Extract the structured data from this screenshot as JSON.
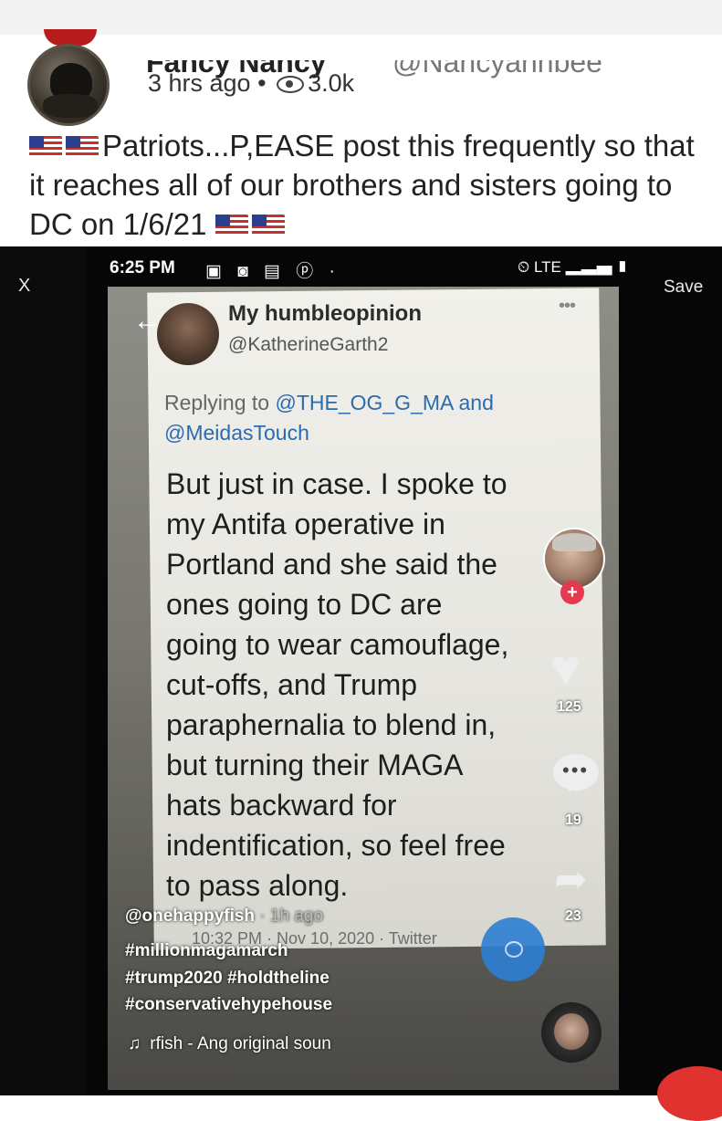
{
  "post": {
    "name": "Fancy Nancy",
    "handle": "@Nancyannbee",
    "time": "3 hrs ago",
    "separator": "•",
    "views": "3.0k",
    "text_main": "Patriots...P,EASE post this frequently so that it reaches all of our brothers and sisters going to DC on 1/6/21"
  },
  "video": {
    "status_time": "6:25 PM",
    "status_right": "LTE",
    "close_label": "X",
    "save_label": "Save",
    "tweet": {
      "name": "My humbleopinion",
      "handle": "@KatherineGarth2",
      "replying_prefix": "Replying to",
      "replying_to_1": "@THE_OG_G_MA and",
      "replying_to_2": "@MeidasTouch",
      "body_lines": [
        "But just in case. I spoke to",
        "my Antifa operative in",
        "Portland and she said the",
        "ones going to DC  are",
        "going to wear camouflage,",
        "cut-offs, and Trump",
        "paraphernalia to blend in,",
        "but turning their MAGA",
        "hats backward for",
        "indentification, so feel free",
        "to pass along."
      ],
      "date": "10:32 PM · Nov 10, 2020 · Twitter"
    },
    "username": "@onehappyfish",
    "username_age": "· 1h ago",
    "hashtags": [
      "#millionmagamarch",
      "#trump2020 #holdtheline",
      "#conservativehypehouse"
    ],
    "likes": "125",
    "comments": "19",
    "shares": "23",
    "music": "rfish - Ang   original soun"
  }
}
